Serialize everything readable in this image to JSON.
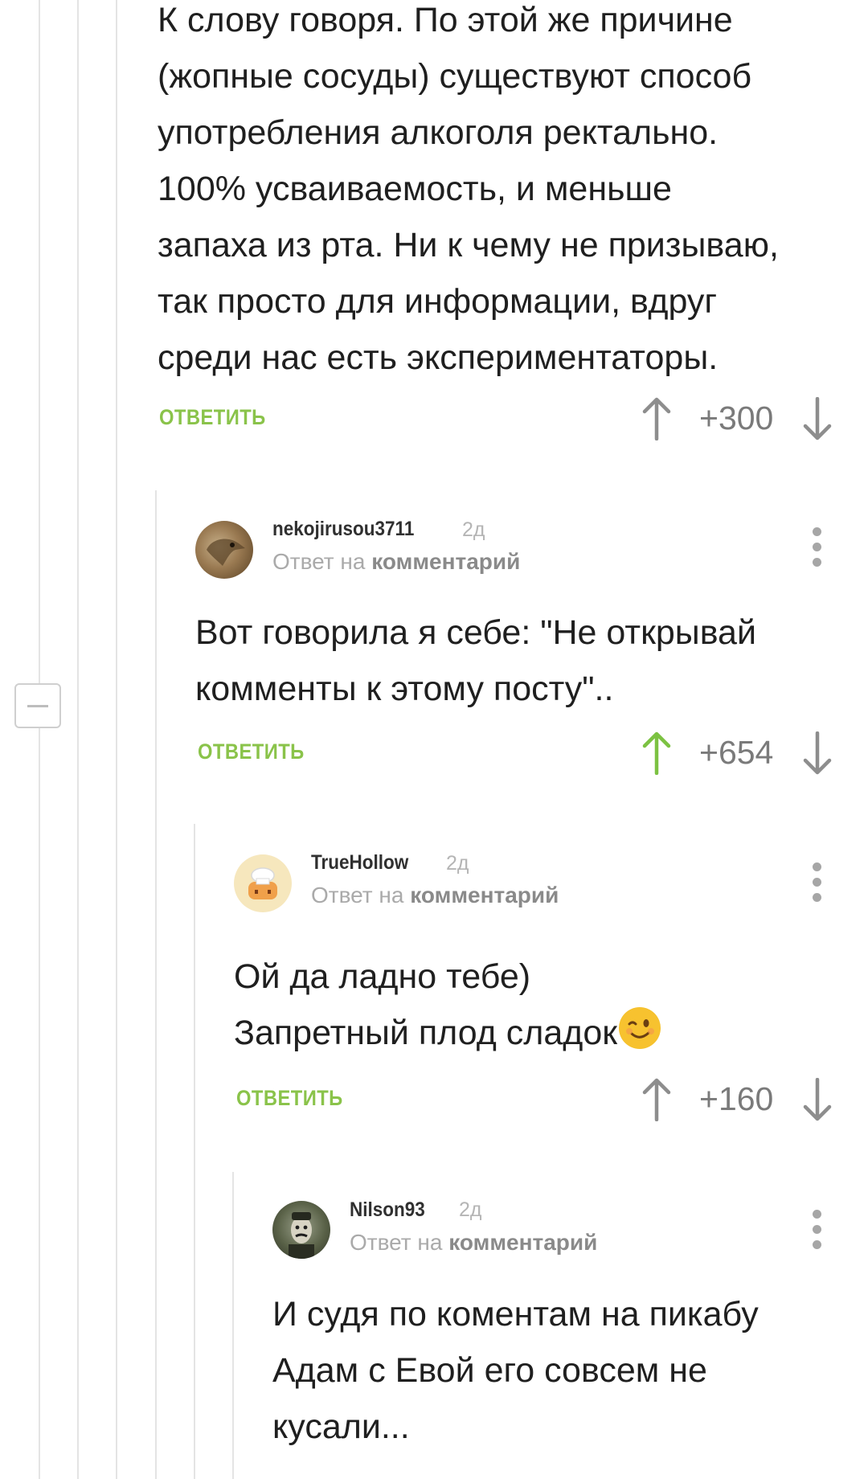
{
  "top_comment": {
    "lines": [
      "К слову говоря. По этой же причине",
      "(жопные сосуды) существуют способ",
      "употребления алкоголя ректально.",
      "100% усваиваемость, и меньше",
      "запаха из рта. Ни к чему не призываю,",
      "так просто для информации, вдруг",
      "среди нас есть экспериментаторы."
    ],
    "reply_label": "ОТВЕТИТЬ",
    "score": "+300"
  },
  "comments": [
    {
      "username": "nekojirusou3711",
      "age": "2д",
      "reply_prefix": "Ответ на",
      "reply_target": "комментарий",
      "lines": [
        "Вот говорила я себе: \"Не открывай",
        "комменты к этому посту\".."
      ],
      "reply_label": "ОТВЕТИТЬ",
      "score": "+654",
      "upvoted": true,
      "avatar_icon": "eagle-avatar-icon"
    },
    {
      "username": "TrueHollow",
      "age": "2д",
      "reply_prefix": "Ответ на",
      "reply_target": "комментарий",
      "lines": [
        "Ой да ладно тебе)",
        "Запретный плод сладок"
      ],
      "emoji": "winking-face-icon",
      "reply_label": "ОТВЕТИТЬ",
      "score": "+160",
      "upvoted": false,
      "avatar_icon": "chef-avatar-icon"
    },
    {
      "username": "Nilson93",
      "age": "2д",
      "reply_prefix": "Ответ на",
      "reply_target": "комментарий",
      "lines": [
        "И судя по коментам на пикабу",
        "Адам с Евой его совсем не",
        "кусали..."
      ],
      "avatar_icon": "portrait-avatar-icon"
    }
  ],
  "colors": {
    "accent_green": "#8ac34a",
    "upvoted_green": "#7cc242",
    "score_gray": "#7a7a7a",
    "thread_line": "#e4e4e4"
  }
}
